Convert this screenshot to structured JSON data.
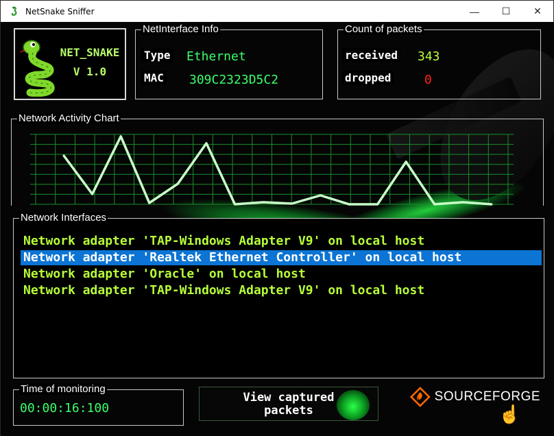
{
  "window": {
    "title": "NetSnake Sniffer",
    "controls": {
      "minimize": "—",
      "maximize": "☐",
      "close": "✕"
    }
  },
  "logo": {
    "name": "NET_SNAKE",
    "version": "V 1.0"
  },
  "net_info": {
    "legend": "NetInterface Info",
    "type_label": "Type",
    "type_value": "Ethernet",
    "mac_label": "MAC",
    "mac_value": "309C2323D5C2"
  },
  "packets": {
    "legend": "Count of packets",
    "received_label": "received",
    "received_value": "343",
    "dropped_label": "dropped",
    "dropped_value": "0"
  },
  "activity": {
    "legend": "Network Activity Chart",
    "line_color": "#c8ffc8",
    "grid_color": "#1a8f2a",
    "values": [
      0.71,
      0.15,
      0.99,
      0.02,
      0.3,
      0.89,
      0.0,
      0.03,
      0.01,
      0.13,
      0.0,
      0.0,
      0.62,
      0.0,
      0.03,
      0.0
    ]
  },
  "interfaces": {
    "legend": "Network Interfaces",
    "items": [
      {
        "text": "Network adapter 'TAP-Windows Adapter V9' on local host",
        "selected": false
      },
      {
        "text": "Network adapter 'Realtek Ethernet Controller' on local host",
        "selected": true
      },
      {
        "text": "Network adapter 'Oracle' on local host",
        "selected": false
      },
      {
        "text": "Network adapter 'TAP-Windows Adapter V9' on local host",
        "selected": false
      }
    ]
  },
  "monitoring": {
    "legend": "Time of monitoring",
    "value": "00:00:16:100"
  },
  "view_button": {
    "line1": "View captured",
    "line2": "packets"
  },
  "sourceforge": {
    "label": "SOURCEFORGE"
  },
  "colors": {
    "accent_green": "#3dff6a",
    "value_green": "#b8ff3a",
    "dropped_red": "#ff2020",
    "selection_blue": "#0b74d4"
  }
}
